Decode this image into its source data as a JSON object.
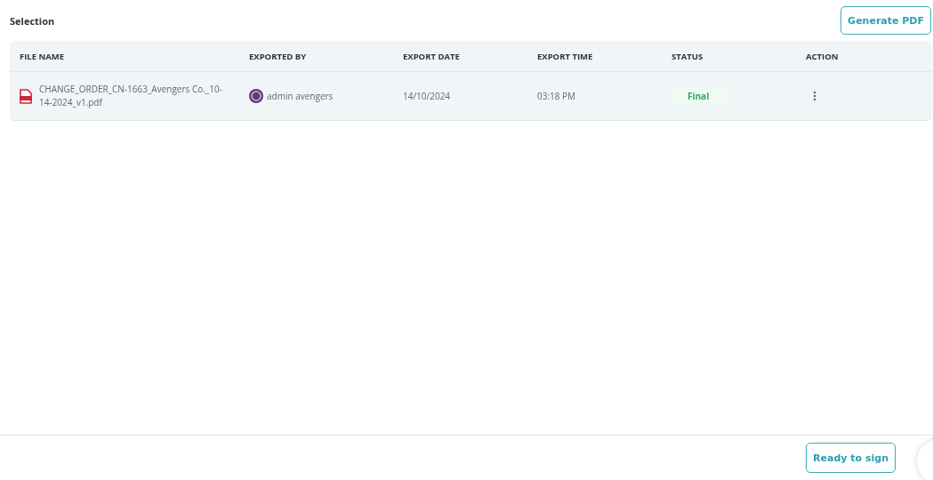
{
  "title": "Selection",
  "header_button": "Generate PDF",
  "table": {
    "columns": [
      "FILE NAME",
      "EXPORTED BY",
      "EXPORT DATE",
      "EXPORT TIME",
      "STATUS",
      "ACTION"
    ],
    "rows": [
      {
        "file_name": "CHANGE_ORDER_CN-1663_Avengers Co._10-14-2024_v1.pdf",
        "exported_by": "admin avengers",
        "export_date": "14/10/2024",
        "export_time": "03:18 PM",
        "status": {
          "kind": "final",
          "label": "Final"
        }
      }
    ]
  },
  "footer_button": "Ready to sign"
}
